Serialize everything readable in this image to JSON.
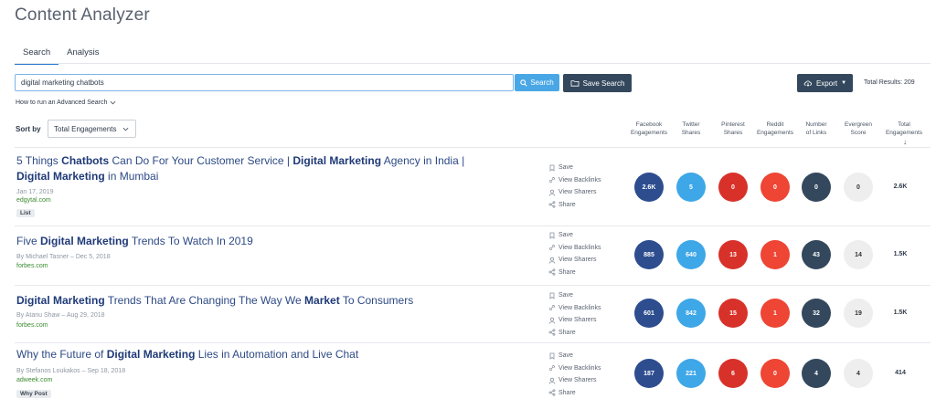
{
  "app": {
    "title": "Content Analyzer"
  },
  "tabs": [
    {
      "label": "Search",
      "active": true
    },
    {
      "label": "Analysis",
      "active": false
    }
  ],
  "search": {
    "query": "digital marketing chatbots",
    "button_label": "Search"
  },
  "toolbar": {
    "save_search_label": "Save Search",
    "export_label": "Export",
    "total_results": "Total Results: 209"
  },
  "advanced_search": {
    "label": "How to run an Advanced Search"
  },
  "sort": {
    "label": "Sort by",
    "selected": "Total Engagements"
  },
  "columns": {
    "facebook": [
      "Facebook",
      "Engagements"
    ],
    "twitter": [
      "Twitter",
      "Shares"
    ],
    "pinterest": [
      "Pinterest",
      "Shares"
    ],
    "reddit": [
      "Reddit",
      "Engagements"
    ],
    "links": [
      "Number",
      "of Links"
    ],
    "evergreen": [
      "Evergreen",
      "Score"
    ],
    "total": [
      "Total",
      "Engagements"
    ]
  },
  "actions": {
    "save": "Save",
    "backlinks": "View Backlinks",
    "sharers": "View Sharers",
    "share": "Share"
  },
  "results": [
    {
      "title_parts": [
        {
          "text": "5 Things ",
          "bold": false
        },
        {
          "text": "Chatbots",
          "bold": true
        },
        {
          "text": " Can Do For Your Customer Service | ",
          "bold": false
        },
        {
          "text": "Digital Marketing",
          "bold": true
        },
        {
          "text": " Agency in India | ",
          "bold": false
        },
        {
          "text": "Digital Marketing",
          "bold": true
        },
        {
          "text": " in Mumbai",
          "bold": false
        }
      ],
      "meta": "Jan 17, 2019",
      "domain": "edgytal.com",
      "tag": "List",
      "facebook": "2.6K",
      "twitter": "5",
      "pinterest": "0",
      "reddit": "0",
      "links": "0",
      "evergreen": "0",
      "total": "2.6K"
    },
    {
      "title_parts": [
        {
          "text": "Five ",
          "bold": false
        },
        {
          "text": "Digital Marketing",
          "bold": true
        },
        {
          "text": " Trends To Watch In 2019",
          "bold": false
        }
      ],
      "meta": "By Michael Tasner – Dec 5, 2018",
      "domain": "forbes.com",
      "tag": "",
      "facebook": "885",
      "twitter": "640",
      "pinterest": "13",
      "reddit": "1",
      "links": "43",
      "evergreen": "14",
      "total": "1.5K"
    },
    {
      "title_parts": [
        {
          "text": "Digital Marketing",
          "bold": true
        },
        {
          "text": " Trends That Are Changing The Way We ",
          "bold": false
        },
        {
          "text": "Market",
          "bold": true
        },
        {
          "text": " To Consumers",
          "bold": false
        }
      ],
      "meta": "By Atanu Shaw – Aug 29, 2018",
      "domain": "forbes.com",
      "tag": "",
      "facebook": "601",
      "twitter": "842",
      "pinterest": "15",
      "reddit": "1",
      "links": "32",
      "evergreen": "19",
      "total": "1.5K"
    },
    {
      "title_parts": [
        {
          "text": "Why the Future of ",
          "bold": false
        },
        {
          "text": "Digital Marketing",
          "bold": true
        },
        {
          "text": " Lies in Automation and Live Chat",
          "bold": false
        }
      ],
      "meta": "By Stefanos Loukakos – Sep 18, 2018",
      "domain": "adweek.com",
      "tag": "Why Post",
      "facebook": "187",
      "twitter": "221",
      "pinterest": "6",
      "reddit": "0",
      "links": "4",
      "evergreen": "4",
      "total": "414"
    }
  ],
  "colors": {
    "facebook": "#2d4d8f",
    "twitter": "#3ea7e8",
    "pinterest": "#d8312a",
    "reddit": "#ee4534",
    "links": "#34485d",
    "evergreen": "#eeeeee",
    "accent": "#4aa7e6",
    "title_link": "#2d4a85",
    "domain": "#3a8a2e"
  }
}
